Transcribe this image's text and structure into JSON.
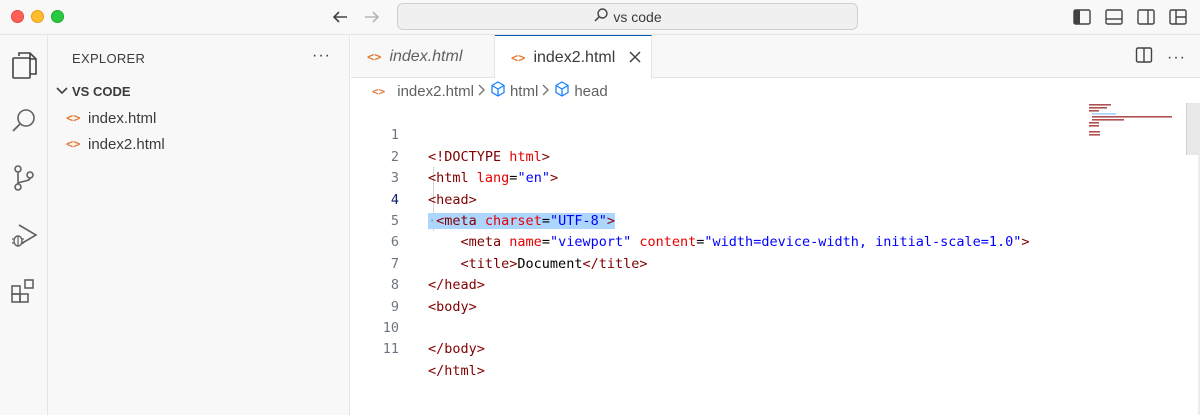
{
  "titlebar": {
    "search_text": "vs code"
  },
  "sidebar": {
    "header": "EXPLORER",
    "more": "···",
    "folder_name": "VS CODE",
    "files": [
      {
        "name": "index.html"
      },
      {
        "name": "index2.html"
      }
    ]
  },
  "tabs": [
    {
      "label": "index.html",
      "active": false
    },
    {
      "label": "index2.html",
      "active": true
    }
  ],
  "breadcrumb": {
    "file": "index2.html",
    "items": [
      "html",
      "head"
    ]
  },
  "editor": {
    "active_line": 4,
    "lines": [
      {
        "n": "1",
        "text": "<!DOCTYPE html>"
      },
      {
        "n": "2",
        "text": "<html lang=\"en\">"
      },
      {
        "n": "3",
        "text": "<head>"
      },
      {
        "n": "4",
        "text": "<meta charset=\"UTF-8\">"
      },
      {
        "n": "5",
        "text": "<meta name=\"viewport\" content=\"width=device-width, initial-scale=1.0\">"
      },
      {
        "n": "6",
        "text": "<title>Document</title>"
      },
      {
        "n": "7",
        "text": "</head>"
      },
      {
        "n": "8",
        "text": "<body>"
      },
      {
        "n": "9",
        "text": ""
      },
      {
        "n": "10",
        "text": "</body>"
      },
      {
        "n": "11",
        "text": "</html>"
      }
    ]
  },
  "colors": {
    "tag": "#800000",
    "attribute": "#e50000",
    "value": "#0000ff",
    "selection": "#add6ff",
    "file_icon": "#e37933",
    "active_tab_border": "#005fb8"
  }
}
